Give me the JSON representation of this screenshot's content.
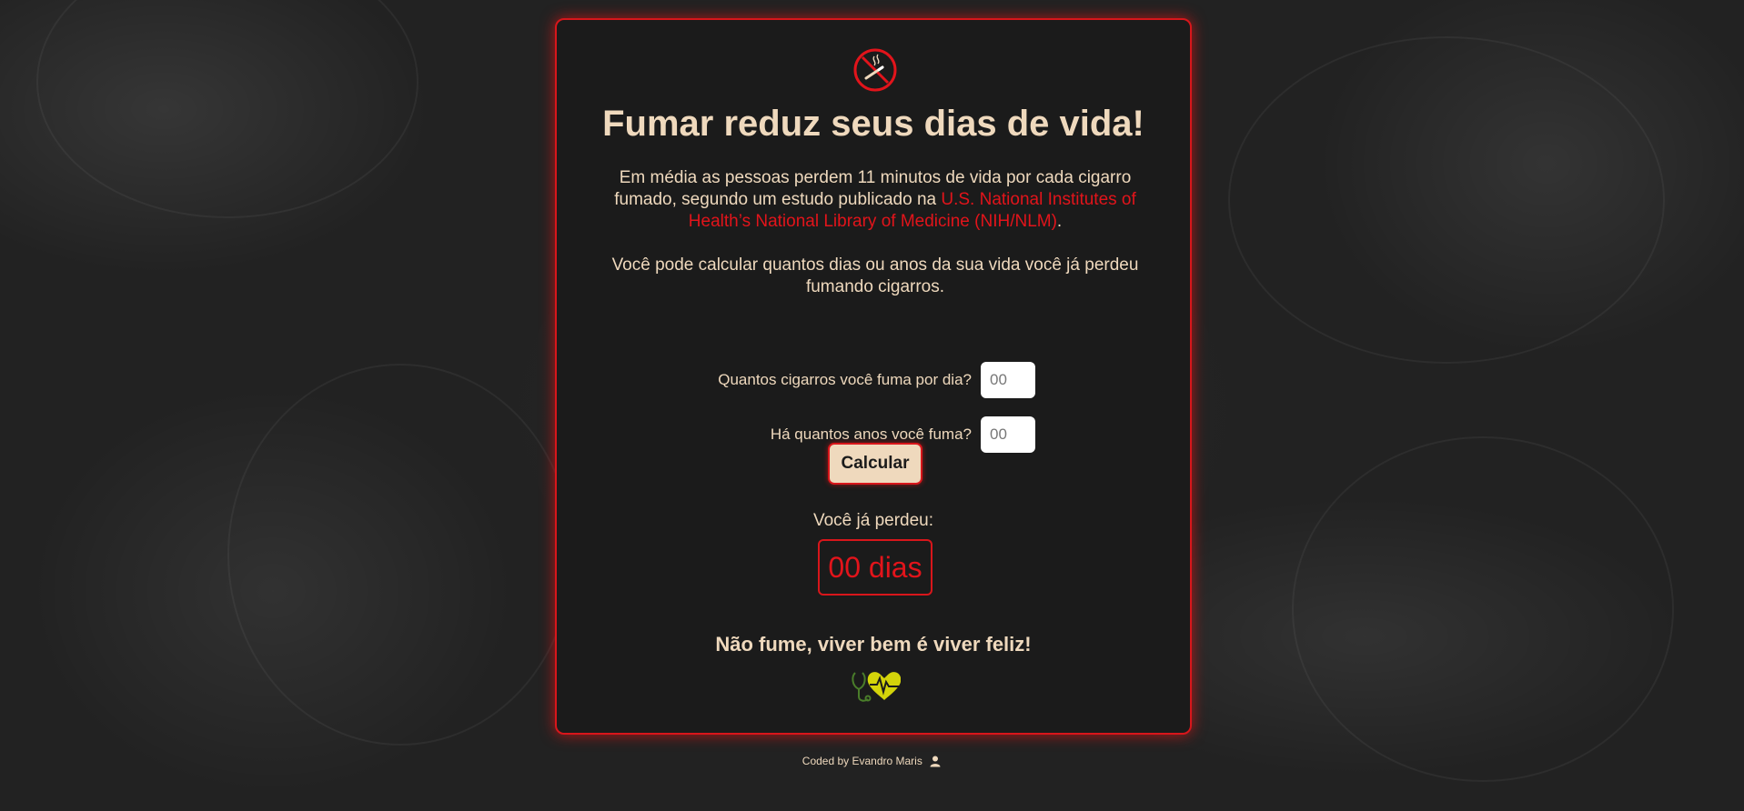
{
  "header": {
    "logo_icon": "no-smoking-icon",
    "title": "Fumar reduz seus dias de vida!"
  },
  "intro": {
    "text_before_link": "Em média as pessoas perdem 11 minutos de vida por cada cigarro fumado, segundo um estudo publicado na ",
    "link_text": "U.S. National Institutes of Health’s National Library of Medicine (NIH/NLM)",
    "text_after_link": ".",
    "paragraph2": "Você pode calcular quantos dias ou anos da sua vida você já perdeu fumando cigarros."
  },
  "form": {
    "cigarettes_label": "Quantos cigarros você fuma por dia?",
    "cigarettes_placeholder": "00",
    "years_label": "Há quantos anos você fuma?",
    "years_placeholder": "00",
    "calc_button": "Calcular"
  },
  "result": {
    "label": "Você já perdeu:",
    "value": "00 dias"
  },
  "closing": {
    "slogan": "Não fume, viver bem é viver feliz!",
    "icon": "heart-stethoscope-icon"
  },
  "footer": {
    "credit": "Coded by Evandro Maris",
    "icon": "user-icon"
  },
  "colors": {
    "accent_red": "#e2141b",
    "text_cream": "#efd9bd",
    "card_bg": "#1b1b1b",
    "page_bg": "#222222",
    "health_yellow": "#d4d40a"
  }
}
